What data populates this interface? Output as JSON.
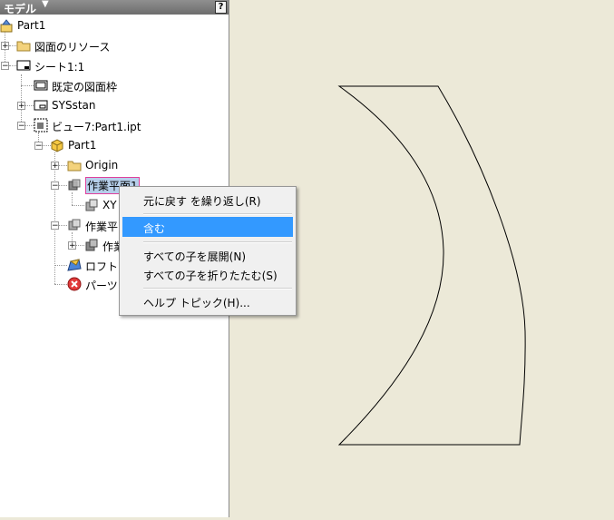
{
  "panel": {
    "title": "モデル",
    "help_label": "?"
  },
  "tree": {
    "root": "Part1",
    "sheet_resources": "図面のリソース",
    "sheet": "シート1:1",
    "default_border": "既定の図面枠",
    "title_block": "SYSstan",
    "view": "ビュー7:Part1.ipt",
    "part": "Part1",
    "origin": "Origin",
    "work_plane_1": "作業平面1",
    "xy_child": "XY",
    "work_plane_2": "作業平",
    "work_plane_2_child": "作業",
    "loft": "ロフト",
    "part_error": "パーツ"
  },
  "context_menu": {
    "items": [
      "元に戻す を繰り返し(R)",
      "含む",
      "すべての子を展開(N)",
      "すべての子を折りたたむ(S)",
      "ヘルプ トピック(H)..."
    ],
    "highlighted": "含む"
  },
  "colors": {
    "canvas_bg": "#ece9d8",
    "menu_highlight": "#3399ff",
    "selection_border": "#e0409c"
  }
}
